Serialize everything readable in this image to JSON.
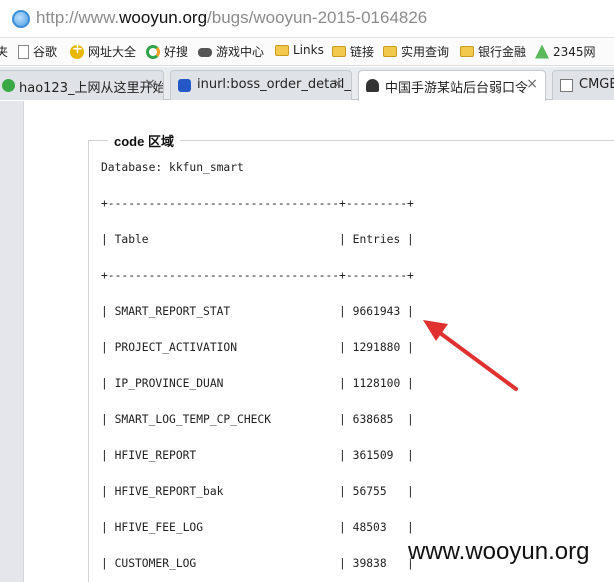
{
  "browser": {
    "url_prefix": "http://www.",
    "url_host": "wooyun.org",
    "url_path": "/bugs/wooyun-2015-0164826"
  },
  "bookmarks": [
    {
      "label": "夹",
      "icon": "none"
    },
    {
      "label": "谷歌",
      "icon": "doc-icon"
    },
    {
      "label": "网址大全",
      "icon": "hao123-icon"
    },
    {
      "label": "好搜",
      "icon": "360-search-icon"
    },
    {
      "label": "游戏中心",
      "icon": "gamepad-icon"
    },
    {
      "label": "Links",
      "icon": "folder-icon"
    },
    {
      "label": "链接",
      "icon": "folder-icon"
    },
    {
      "label": "实用查询",
      "icon": "folder-icon"
    },
    {
      "label": "银行金融",
      "icon": "folder-icon"
    },
    {
      "label": "2345网",
      "icon": "2345-icon"
    }
  ],
  "tabs": [
    {
      "title": "hao123_上网从这里开始",
      "close": "×",
      "icon": "hao123-icon"
    },
    {
      "title": "inurl:boss_order_detail_",
      "close": "×",
      "icon": "paw-icon"
    },
    {
      "title": "中国手游某站后台弱口令",
      "close": "×",
      "icon": "wooyun-icon",
      "active": true
    },
    {
      "title": "CMGE",
      "close": "",
      "icon": "doc-icon"
    }
  ],
  "code_block": {
    "legend": "code 区域",
    "lines": [
      "Database: kkfun_smart",
      "+----------------------------------+---------+",
      "| Table                            | Entries |",
      "+----------------------------------+---------+",
      "| SMART_REPORT_STAT                | 9661943 |",
      "| PROJECT_ACTIVATION               | 1291880 |",
      "| IP_PROVINCE_DUAN                 | 1128100 |",
      "| SMART_LOG_TEMP_CP_CHECK          | 638685  |",
      "| HFIVE_REPORT                     | 361509  |",
      "| HFIVE_REPORT_bak                 | 56755   |",
      "| HFIVE_FEE_LOG                    | 48503   |",
      "| CUSTOMER_LOG                     | 39838   |"
    ]
  },
  "annotation": {
    "color": "#e03030"
  },
  "watermark": "www.wooyun.org"
}
